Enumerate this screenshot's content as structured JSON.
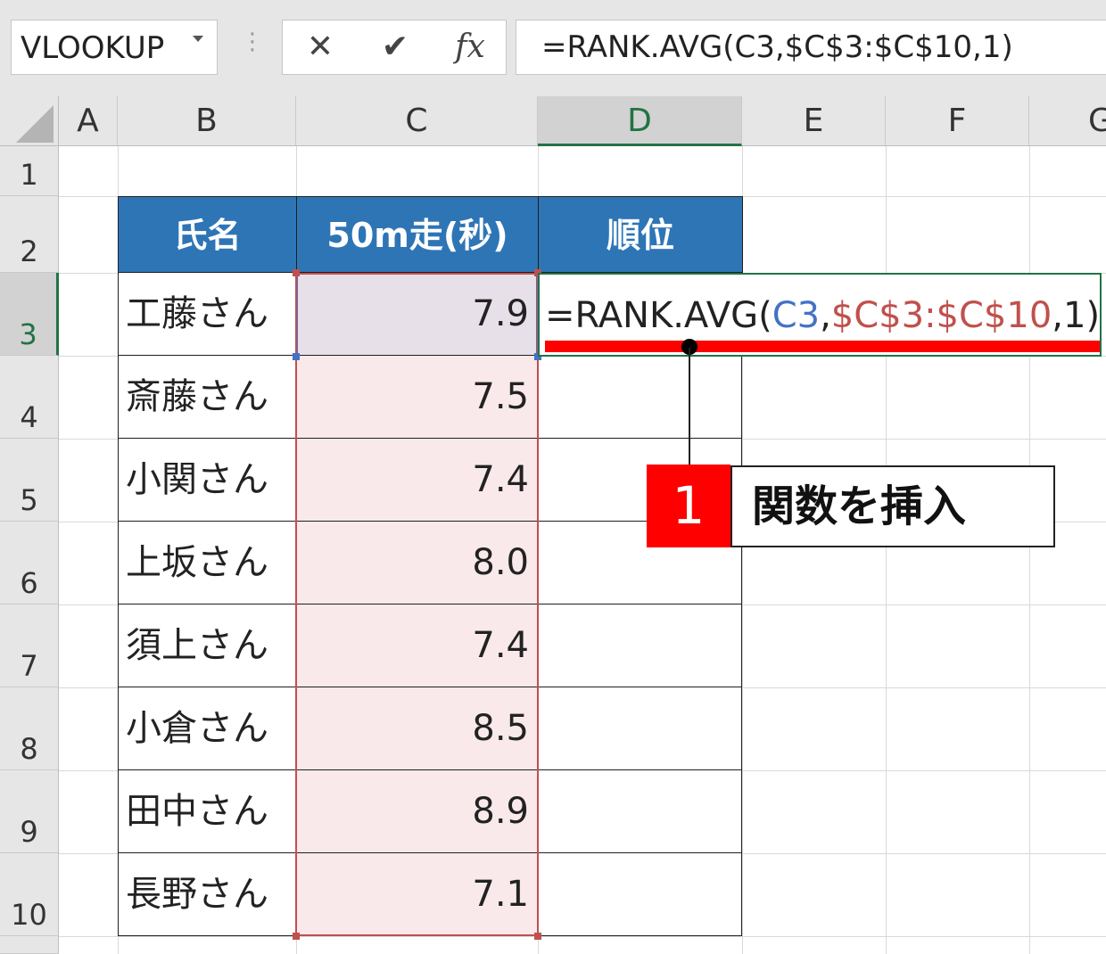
{
  "formula_bar": {
    "name_box": "VLOOKUP",
    "cancel_symbol": "✕",
    "enter_symbol": "✔",
    "fx_symbol": "fx",
    "formula": "=RANK.AVG(C3,$C$3:$C$10,1)"
  },
  "columns": [
    "A",
    "B",
    "C",
    "D",
    "E",
    "F",
    "G"
  ],
  "rows": [
    "1",
    "2",
    "3",
    "4",
    "5",
    "6",
    "7",
    "8",
    "9",
    "10"
  ],
  "table": {
    "headers": [
      "氏名",
      "50m走(秒)",
      "順位"
    ],
    "rows": [
      {
        "name": "工藤さん",
        "time": "7.9"
      },
      {
        "name": "斎藤さん",
        "time": "7.5"
      },
      {
        "name": "小関さん",
        "time": "7.4"
      },
      {
        "name": "上坂さん",
        "time": "8.0"
      },
      {
        "name": "須上さん",
        "time": "7.4"
      },
      {
        "name": "小倉さん",
        "time": "8.5"
      },
      {
        "name": "田中さん",
        "time": "8.9"
      },
      {
        "name": "長野さん",
        "time": "7.1"
      }
    ]
  },
  "cell_edit": {
    "prefix": "=RANK.AVG(",
    "ref1": "C3",
    "sep": ",",
    "ref2": "$C$3:$C$10",
    "suffix": ",1)"
  },
  "callout": {
    "number": "1",
    "text": "関数を挿入"
  },
  "colors": {
    "header_fill": "#2e75b6",
    "range_fill": "#f9e9ea",
    "range_border": "#c0504d",
    "ref_blue": "#4472c4",
    "accent_red": "#ff0000",
    "excel_green": "#217346"
  }
}
